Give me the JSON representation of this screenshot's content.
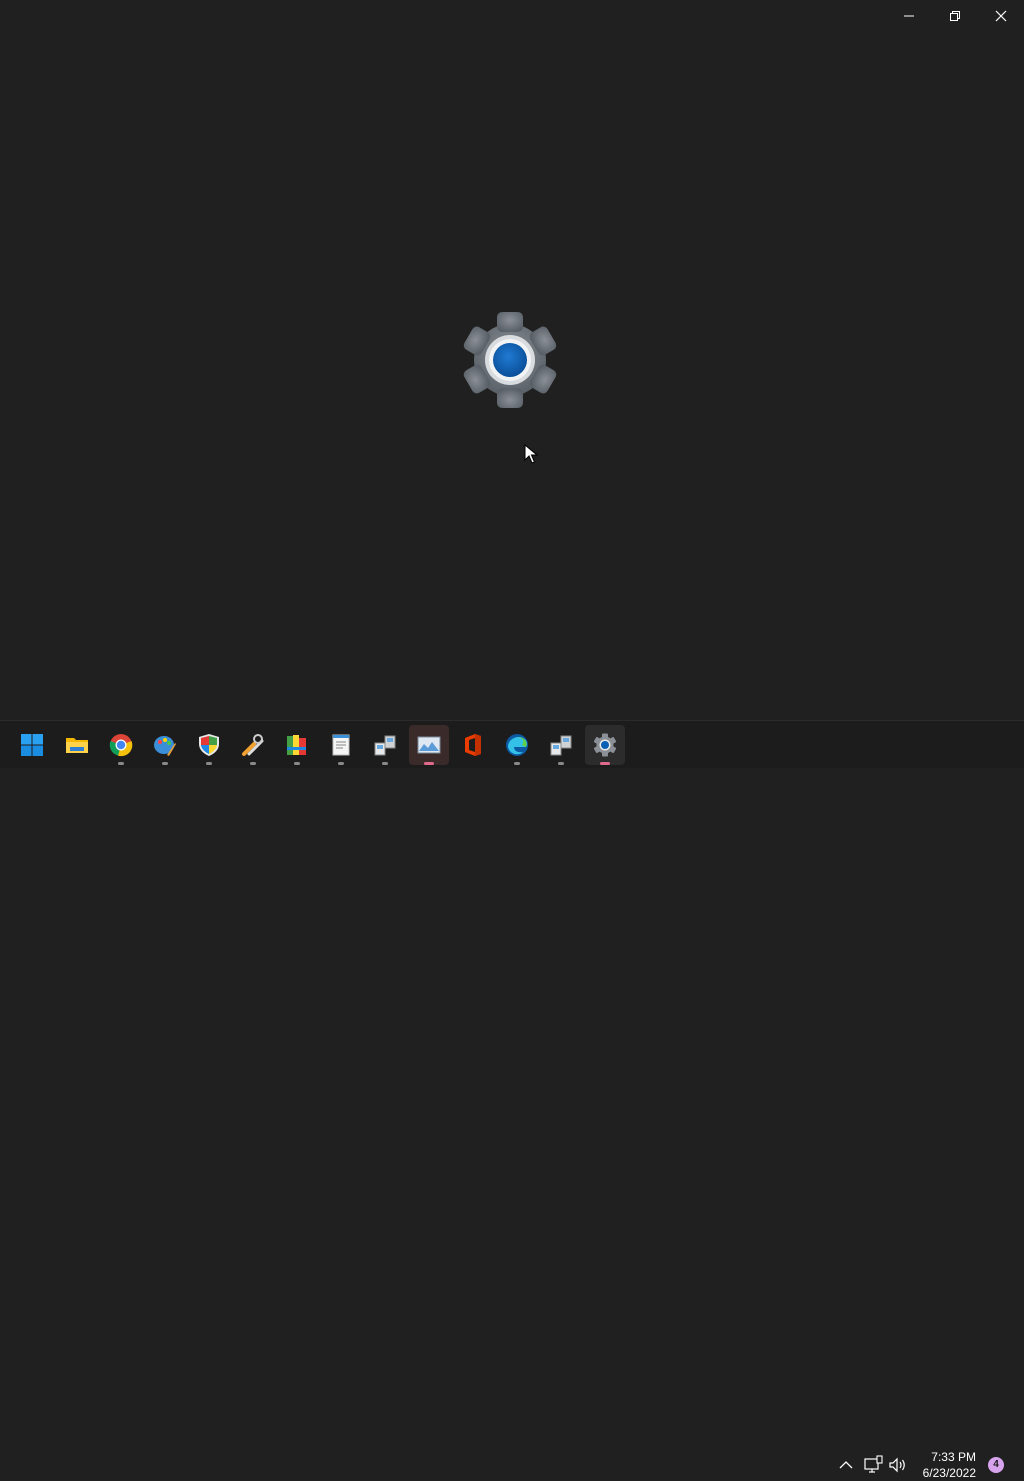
{
  "window": {
    "caption_buttons": [
      "minimize",
      "restore",
      "close"
    ],
    "splash_icon": "settings-gear-icon"
  },
  "taskbar": {
    "apps": [
      {
        "name": "start",
        "icon": "windows-start-icon"
      },
      {
        "name": "file-explorer",
        "icon": "folder-icon"
      },
      {
        "name": "chrome",
        "icon": "chrome-icon"
      },
      {
        "name": "paint",
        "icon": "palette-icon"
      },
      {
        "name": "security",
        "icon": "shield-icon"
      },
      {
        "name": "tools",
        "icon": "wrench-icon"
      },
      {
        "name": "app-books",
        "icon": "books-icon"
      },
      {
        "name": "notepad",
        "icon": "document-icon"
      },
      {
        "name": "network",
        "icon": "network-computers-icon"
      },
      {
        "name": "photos",
        "icon": "image-icon"
      },
      {
        "name": "office",
        "icon": "office-icon"
      },
      {
        "name": "edge",
        "icon": "edge-icon"
      },
      {
        "name": "network2",
        "icon": "network-computers-icon"
      },
      {
        "name": "settings",
        "icon": "gear-icon"
      }
    ],
    "tray": {
      "time": "7:33 PM",
      "date": "6/23/2022",
      "notification_count": "4"
    }
  },
  "colors": {
    "background": "#202020",
    "taskbar": "#1c1c1c",
    "accent": "#0063b1",
    "notification_badge": "#d7a3ec"
  }
}
